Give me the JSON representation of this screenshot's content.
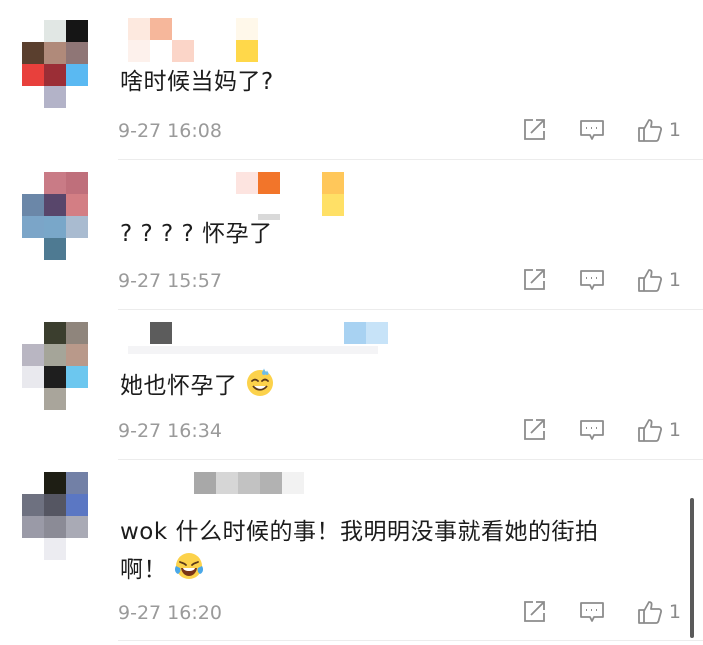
{
  "comments": [
    {
      "text": "啥时候当妈了?",
      "time": "9-27 16:08",
      "likes": "1"
    },
    {
      "text": "? ? ? ? 怀孕了",
      "time": "9-27 15:57",
      "likes": "1"
    },
    {
      "text": "她也怀孕了",
      "time": "9-27 16:34",
      "likes": "1",
      "emoji": "sweat-smile-emoji"
    },
    {
      "text_line1": "wok 什么时候的事！我明明没事就看她的街拍",
      "text_line2": "啊！",
      "time": "9-27 16:20",
      "likes": "1",
      "emoji": "laughing-crying-emoji"
    }
  ],
  "icons": {
    "share": "share-icon",
    "reply": "comment-icon",
    "like": "thumbs-up-icon"
  },
  "colors": {
    "meta_text": "#9a9a9a",
    "icon_stroke": "#8c8c8c"
  }
}
